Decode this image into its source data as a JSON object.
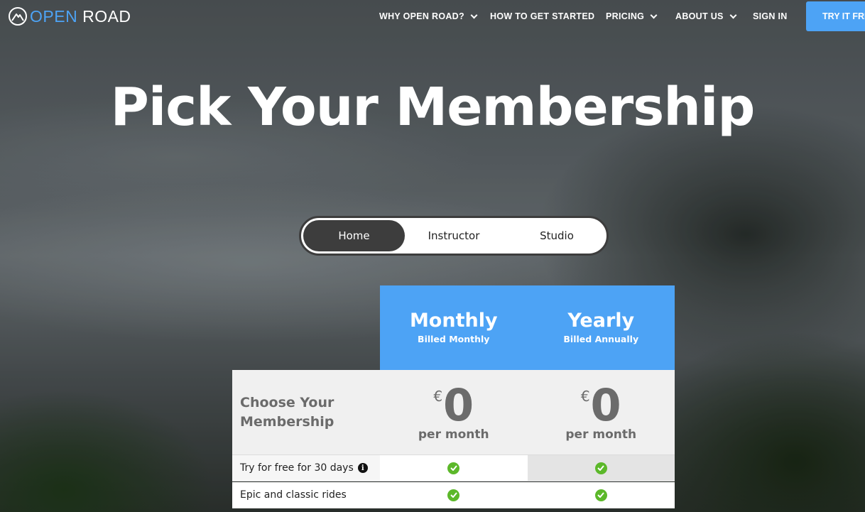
{
  "brand": {
    "logo_open": "OPEN",
    "logo_road": "ROAD"
  },
  "nav": {
    "items": [
      {
        "label": "WHY OPEN ROAD?",
        "has_dropdown": true
      },
      {
        "label": "HOW TO GET STARTED",
        "has_dropdown": false
      },
      {
        "label": "PRICING",
        "has_dropdown": true
      },
      {
        "label": "ABOUT US",
        "has_dropdown": true
      },
      {
        "label": "SIGN IN",
        "has_dropdown": false
      }
    ],
    "cta_label": "TRY IT FREE"
  },
  "hero": {
    "title": "Pick Your Membership"
  },
  "toggle": {
    "options": [
      "Home",
      "Instructor",
      "Studio"
    ],
    "selected": "Home"
  },
  "pricing": {
    "plans": [
      {
        "name": "Monthly",
        "billing": "Billed Monthly",
        "currency": "€",
        "amount": "0",
        "period": "per month"
      },
      {
        "name": "Yearly",
        "billing": "Billed Annually",
        "currency": "€",
        "amount": "0",
        "period": "per month"
      }
    ],
    "row_title": "Choose Your Membership",
    "features": [
      {
        "label": "Try for free for 30 days",
        "has_info": true,
        "monthly": true,
        "yearly": true
      },
      {
        "label": "Epic and classic rides",
        "has_info": false,
        "monthly": true,
        "yearly": true
      }
    ]
  },
  "colors": {
    "accent": "#4da3f5",
    "toggle_active": "#3d3d3d",
    "check": "#5cb82a"
  }
}
